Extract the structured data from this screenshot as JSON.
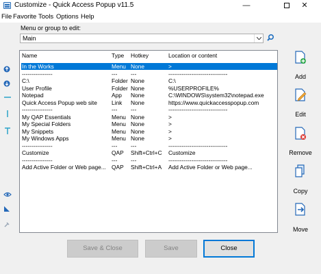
{
  "window": {
    "title": "Customize - Quick Access Popup v11.5"
  },
  "menubar": [
    {
      "label": "File",
      "name": "menu-file"
    },
    {
      "label": "Favorite",
      "name": "menu-favorite"
    },
    {
      "label": "Tools",
      "name": "menu-tools"
    },
    {
      "label": "Options",
      "name": "menu-options"
    },
    {
      "label": "Help",
      "name": "menu-help"
    }
  ],
  "menu_select": {
    "label": "Menu or group to edit:",
    "value": "Main"
  },
  "list": {
    "columns": [
      "Name",
      "Type",
      "Hotkey",
      "Location or content"
    ],
    "rows": [
      {
        "name": "In the Works",
        "type": "Menu",
        "hotkey": "None",
        "location": ">",
        "selected": true
      },
      {
        "name": "----------------",
        "type": "---",
        "hotkey": "---",
        "location": "-------------------------------"
      },
      {
        "name": "C:\\",
        "type": "Folder",
        "hotkey": "None",
        "location": "C:\\"
      },
      {
        "name": "User Profile",
        "type": "Folder",
        "hotkey": "None",
        "location": "%USERPROFILE%"
      },
      {
        "name": "Notepad",
        "type": "App",
        "hotkey": "None",
        "location": "C:\\WINDOWS\\system32\\notepad.exe"
      },
      {
        "name": "Quick Access Popup web site",
        "type": "Link",
        "hotkey": "None",
        "location": "https://www.quickaccesspopup.com"
      },
      {
        "name": "----------------",
        "type": "---",
        "hotkey": "---",
        "location": "-------------------------------"
      },
      {
        "name": "My QAP Essentials",
        "type": "Menu",
        "hotkey": "None",
        "location": ">"
      },
      {
        "name": "My Special Folders",
        "type": "Menu",
        "hotkey": "None",
        "location": ">"
      },
      {
        "name": "My Snippets",
        "type": "Menu",
        "hotkey": "None",
        "location": ">"
      },
      {
        "name": "My Windows Apps",
        "type": "Menu",
        "hotkey": "None",
        "location": ">"
      },
      {
        "name": "----------------",
        "type": "---",
        "hotkey": "---",
        "location": "-------------------------------"
      },
      {
        "name": "Customize",
        "type": "QAP",
        "hotkey": "Shift+Ctrl+C",
        "location": "Customize"
      },
      {
        "name": "----------------",
        "type": "---",
        "hotkey": "---",
        "location": "-------------------------------"
      },
      {
        "name": "Add Active Folder or Web page...",
        "type": "QAP",
        "hotkey": "Shift+Ctrl+A",
        "location": "Add Active Folder or Web page..."
      }
    ]
  },
  "actions": {
    "add": "Add",
    "edit": "Edit",
    "remove": "Remove",
    "copy": "Copy",
    "move": "Move"
  },
  "buttons": {
    "save_close": "Save & Close",
    "save": "Save",
    "close": "Close"
  }
}
